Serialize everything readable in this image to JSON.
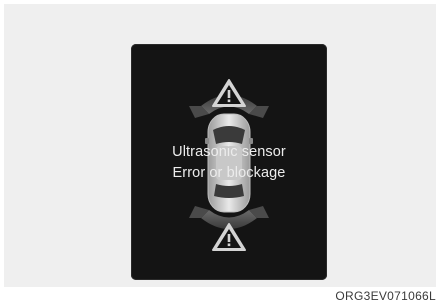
{
  "display": {
    "message_line1": "Ultrasonic sensor",
    "message_line2": "Error or blockage",
    "front_warning_icon": "warning-triangle-icon",
    "rear_warning_icon": "warning-triangle-icon",
    "vehicle_icon": "car-top-view-icon"
  },
  "caption": "ORG3EV071066L",
  "colors": {
    "screen_background": "#141414",
    "text": "#ececec",
    "warning_fill": "#cfcfcf"
  }
}
